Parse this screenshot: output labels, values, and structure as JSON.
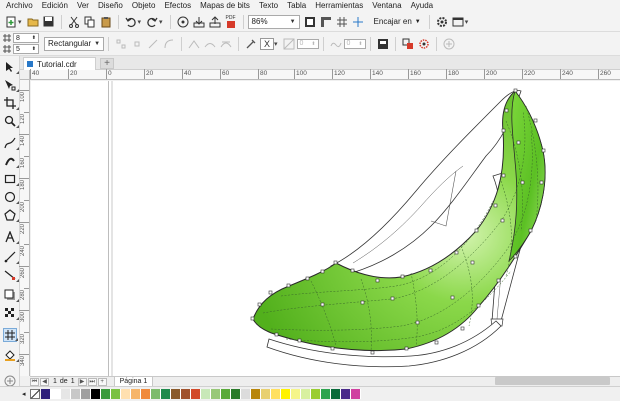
{
  "menu": [
    "Archivo",
    "Edición",
    "Ver",
    "Diseño",
    "Objeto",
    "Efectos",
    "Mapas de bits",
    "Texto",
    "Tabla",
    "Herramientas",
    "Ventana",
    "Ayuda"
  ],
  "toolbar": {
    "zoom_value": "86%",
    "snap_label": "Encajar en",
    "pdf_label": "PDF"
  },
  "propbar": {
    "width_value": "8",
    "height_value": "5",
    "mode_value": "Rectangular",
    "field_a": "0",
    "field_b": "0",
    "opacity_disabled": "X"
  },
  "tab": {
    "name": "Tutorial.cdr",
    "add": "+"
  },
  "ruler_h": [
    "40",
    "20",
    "0",
    "20",
    "40",
    "60",
    "80",
    "100",
    "120",
    "140",
    "160",
    "180",
    "200",
    "220",
    "240",
    "260"
  ],
  "ruler_v": [
    "100",
    "120",
    "140",
    "160",
    "180",
    "200",
    "220",
    "240",
    "260",
    "280",
    "300",
    "320",
    "340"
  ],
  "pagebar": {
    "current": "1",
    "of_label": "de",
    "total": "1",
    "page_name": "Página 1"
  },
  "palette": [
    "#2e1f7a",
    "#ffffff",
    "#e6e6e6",
    "#c8c8c8",
    "#a0a0a0",
    "#000000",
    "#3a9a3c",
    "#7ac143",
    "#ffe0b0",
    "#f6b56a",
    "#f08a3c",
    "#7dbb6c",
    "#1f8a4c",
    "#8a5a2b",
    "#a0522d",
    "#d24a2a",
    "#c8e8b8",
    "#98c878",
    "#5aaa3a",
    "#2a7a2a",
    "#dcdcdc",
    "#b8860b",
    "#e8d070",
    "#ffe060",
    "#fff200",
    "#f5f58a",
    "#d8f0a0",
    "#9acd32",
    "#2ea44f",
    "#0a6a3a",
    "#4a2a8a",
    "#d040a0"
  ],
  "colors": {
    "shoe_fill": "#6cc92c",
    "shoe_highlight": "#c8f0a0",
    "accent": "#2878c8"
  }
}
